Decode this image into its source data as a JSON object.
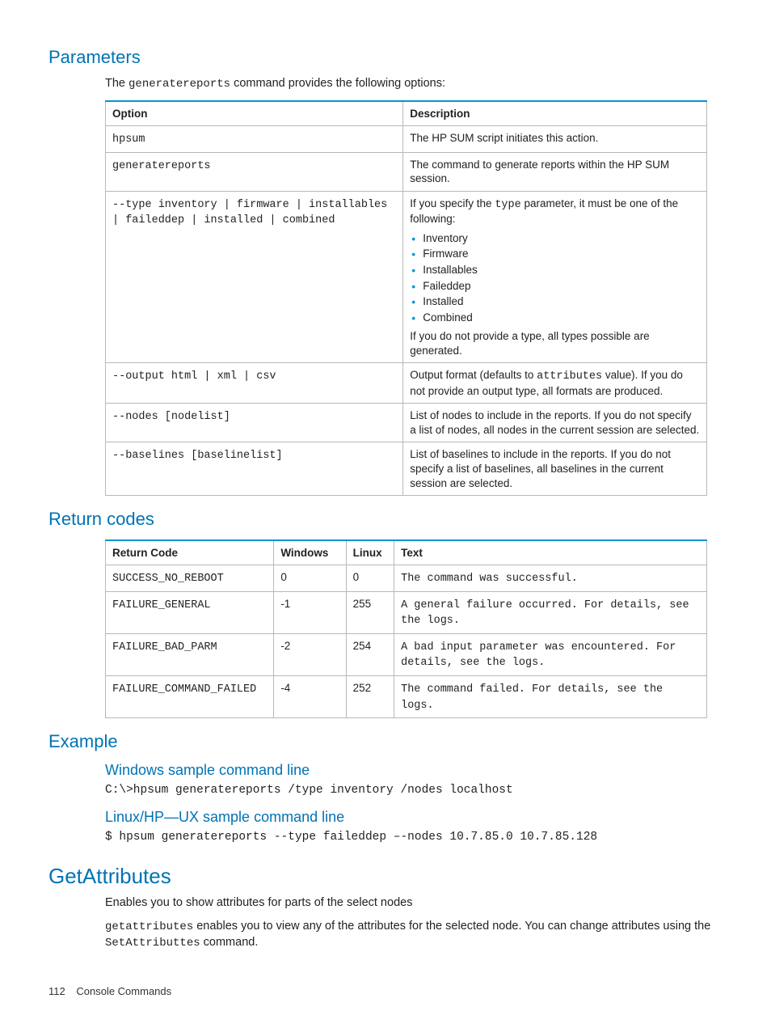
{
  "section_parameters": {
    "heading": "Parameters",
    "intro_prefix": "The ",
    "intro_code": "generatereports",
    "intro_suffix": " command provides the following options:",
    "table": {
      "headers": {
        "option": "Option",
        "description": "Description"
      },
      "rows": {
        "r0": {
          "option": "hpsum",
          "description": "The HP SUM script initiates this action."
        },
        "r1": {
          "option": "generatereports",
          "description": "The command to generate reports within the HP SUM session."
        },
        "r2": {
          "option": "--type inventory | firmware | installables | faileddep | installed | combined",
          "desc_pre_1": "If you specify the ",
          "desc_code_1": "type",
          "desc_post_1": " parameter, it must be one of the following:",
          "bullets": {
            "b0": "Inventory",
            "b1": "Firmware",
            "b2": "Installables",
            "b3": "Faileddep",
            "b4": "Installed",
            "b5": "Combined"
          },
          "desc_after": "If you do not provide a type, all types possible are generated."
        },
        "r3": {
          "option": "--output html | xml | csv",
          "desc_pre_1": "Output format (defaults to ",
          "desc_code_1": "attributes",
          "desc_post_1": " value). If you do not provide an output type, all formats are produced."
        },
        "r4": {
          "option": "--nodes [nodelist]",
          "description": "List of nodes to include in the reports. If you do not specify a list of nodes, all nodes in the current session are selected."
        },
        "r5": {
          "option": "--baselines [baselinelist]",
          "description": "List of baselines to include in the reports. If you do not specify a list of baselines, all baselines in the current session are selected."
        }
      }
    }
  },
  "section_returncodes": {
    "heading": "Return codes",
    "table": {
      "headers": {
        "code": "Return Code",
        "windows": "Windows",
        "linux": "Linux",
        "text": "Text"
      },
      "rows": {
        "r0": {
          "code": "SUCCESS_NO_REBOOT",
          "windows": "0",
          "linux": "0",
          "text": "The command was successful."
        },
        "r1": {
          "code": "FAILURE_GENERAL",
          "windows": "-1",
          "linux": "255",
          "text": "A general failure occurred. For details, see the logs."
        },
        "r2": {
          "code": "FAILURE_BAD_PARM",
          "windows": "-2",
          "linux": "254",
          "text": "A bad input parameter was encountered. For details, see the logs."
        },
        "r3": {
          "code": "FAILURE_COMMAND_FAILED",
          "windows": "-4",
          "linux": "252",
          "text": "The command failed. For details, see the logs."
        }
      }
    }
  },
  "section_example": {
    "heading": "Example",
    "windows_heading": "Windows sample command line",
    "windows_cmd": "C:\\>hpsum generatereports /type inventory /nodes localhost",
    "linux_heading": "Linux/HP—UX sample command line",
    "linux_cmd": "$ hpsum generatereports --type faileddep –-nodes 10.7.85.0 10.7.85.128"
  },
  "section_getattributes": {
    "heading": "GetAttributes",
    "line1": "Enables you to show attributes for parts of the select nodes",
    "para_code1": "getattributes",
    "para_mid": " enables you to view any of the attributes for the selected node. You can change attributes using the ",
    "para_code2": "SetAttributtes",
    "para_end": " command."
  },
  "footer": {
    "page_number": "112",
    "title": "Console Commands"
  }
}
